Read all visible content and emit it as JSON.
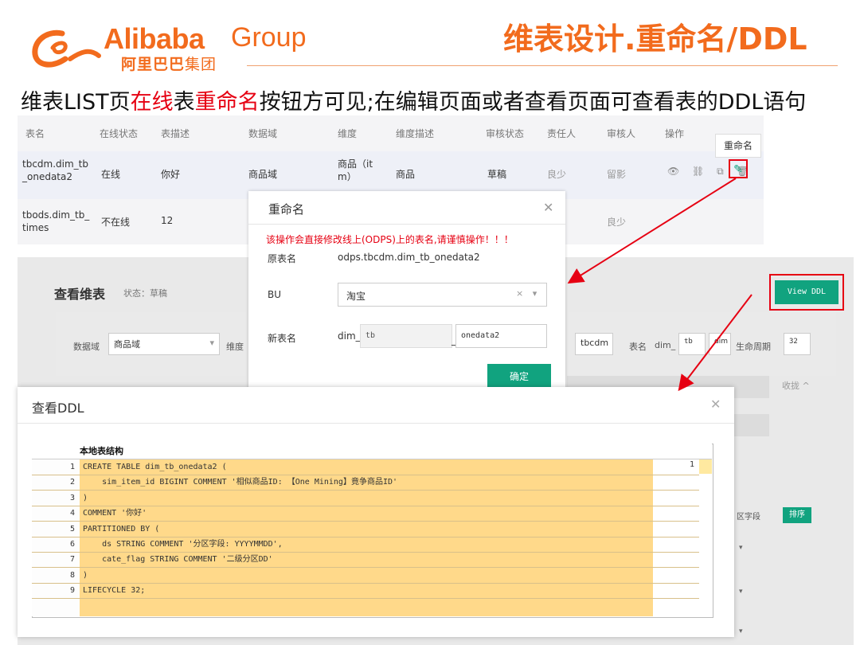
{
  "header": {
    "logo_word": "Alibaba",
    "logo_group": "Group",
    "logo_cn_bold": "阿里巴巴",
    "logo_cn_light": "集团",
    "slide_title": "维表设计.重命名/DDL"
  },
  "subtitle": {
    "part1": "维表LIST页",
    "part2": "在线",
    "part3": "表",
    "part4": "重命名",
    "part5": "按钮方可见;在编辑页面或者查看页面可查看表的DDL语句"
  },
  "table": {
    "headers": [
      "表名",
      "在线状态",
      "表描述",
      "数据域",
      "维度",
      "维度描述",
      "审核状态",
      "责任人",
      "审核人",
      "操作"
    ],
    "rows": [
      [
        "tbcdm.dim_tb\n_onedata2",
        "在线",
        "你好",
        "商品域",
        "商品（it\nm）",
        "商品",
        "草稿",
        "良少",
        "留影"
      ],
      [
        "tbods.dim_tb_\ntimes",
        "不在线",
        "12",
        "",
        "",
        "",
        "",
        "",
        "良少"
      ]
    ],
    "rename_tooltip": "重命名"
  },
  "rename_modal": {
    "title": "重命名",
    "warning": "该操作会直接修改线上(ODPS)上的表名,请谨慎操作！！！",
    "orig_label": "原表名",
    "orig_value": "odps.tbcdm.dim_tb_onedata2",
    "bu_label": "BU",
    "bu_value": "淘宝",
    "new_label": "新表名",
    "new_prefix": "dim_",
    "new_mid": "tb",
    "new_sep": "_",
    "new_end": "onedata2",
    "ok_label": "确定"
  },
  "view_page": {
    "title": "查看维表",
    "status": "状态：草稿",
    "view_ddl": "View DDL",
    "data_domain_label": "数据域",
    "data_domain_value": "商品域",
    "dimension_label": "维度",
    "layer_value": "tbcdm",
    "table_name_label": "表名",
    "table_name_prefix": "dim_",
    "table_name_mid": "tb",
    "table_name_end": "dim",
    "lifecycle_label": "生命周期",
    "lifecycle_value": "32",
    "collapse": "收拢 ^",
    "partition_label": "区字段",
    "sort": "排序"
  },
  "ddl_dialog": {
    "title": "查看DDL",
    "section": "本地表结构",
    "right_value": "1",
    "lines": [
      {
        "n": "1",
        "code": "CREATE TABLE dim_tb_onedata2 ("
      },
      {
        "n": "2",
        "code": "    sim_item_id BIGINT COMMENT '相似商品ID: 【One Mining】竟争商品ID'"
      },
      {
        "n": "3",
        "code": ")"
      },
      {
        "n": "4",
        "code": "COMMENT '你好'"
      },
      {
        "n": "5",
        "code": "PARTITIONED BY ("
      },
      {
        "n": "6",
        "code": "    ds STRING COMMENT '分区字段: YYYYMMDD',"
      },
      {
        "n": "7",
        "code": "    cate_flag STRING COMMENT '二级分区DD'"
      },
      {
        "n": "8",
        "code": ")"
      },
      {
        "n": "9",
        "code": "LIFECYCLE 32;"
      }
    ]
  },
  "colors": {
    "brand_orange": "#f26b1d",
    "accent_red": "#e60012",
    "primary_green": "#11a37f",
    "code_bg": "#ffd98a"
  }
}
